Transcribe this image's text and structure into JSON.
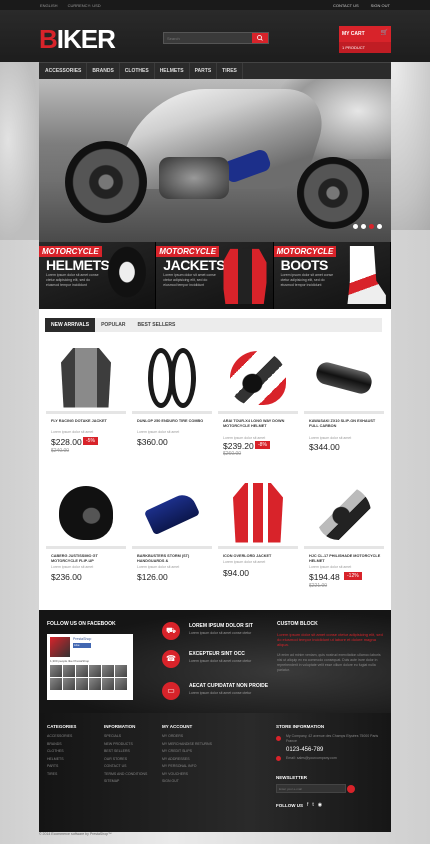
{
  "topbar": {
    "language": "ENGLISH",
    "currency": "CURRENCY: USD",
    "contact": "CONTACT US",
    "signout": "SIGN OUT"
  },
  "header": {
    "logo_first": "B",
    "logo_rest": "IKER",
    "search_placeholder": "Search",
    "cart_label": "MY CART",
    "cart_count": "1 PRODUCT"
  },
  "nav": [
    "ACCESSORIES",
    "BRANDS",
    "CLOTHES",
    "HELMETS",
    "PARTS",
    "TIRES"
  ],
  "banners": [
    {
      "tag": "MOTORCYCLE",
      "big": "HELMETS",
      "text": "Lorem ipsum dolor sit amet conse ctetur adipisicing elit, sed do eiusmod tempor incididunt"
    },
    {
      "tag": "MOTORCYCLE",
      "big": "JACKETS",
      "text": "Lorem ipsum dolor sit amet conse ctetur adipisicing elit, sed do eiusmod tempor incididunt"
    },
    {
      "tag": "MOTORCYCLE",
      "big": "BOOTS",
      "text": "Lorem ipsum dolor sit amet conse ctetur adipisicing elit, sed do eiusmod tempor incididunt"
    }
  ],
  "tabs": [
    "NEW ARRIVALS",
    "POPULAR",
    "BEST SELLERS"
  ],
  "products": [
    {
      "name": "FLY RACING DOTAKE JACKET",
      "desc": "Lorem ipsum dolor sit amet",
      "price": "$228.00",
      "old": "$240.00",
      "discount": "-5%"
    },
    {
      "name": "DUNLOP 250 ENDURO TIRE COMBO",
      "desc": "Lorem ipsum dolor sit amet",
      "price": "$360.00",
      "old": "",
      "discount": ""
    },
    {
      "name": "ARAI TOUR-X4 LONG WAY DOWN MOTORCYCLE HELMET",
      "desc": "Lorem ipsum dolor sit amet",
      "price": "$239.20",
      "old": "$260.00",
      "discount": "-8%"
    },
    {
      "name": "KAWASAKI ZX10 SLIP-ON EXHAUST FULL CARBON",
      "desc": "Lorem ipsum dolor sit amet",
      "price": "$344.00",
      "old": "",
      "discount": ""
    },
    {
      "name": "CABERG JUSTISSIMO GT MOTORCYCLE FLIP-UP",
      "desc": "Lorem ipsum dolor sit amet",
      "price": "$236.00",
      "old": "",
      "discount": ""
    },
    {
      "name": "BARKBUSTERS STORM (ST) HANDGUARDS &",
      "desc": "Lorem ipsum dolor sit amet",
      "price": "$126.00",
      "old": "",
      "discount": ""
    },
    {
      "name": "ICON OVERLORD JACKET",
      "desc": "Lorem ipsum dolor sit amet",
      "price": "$94.00",
      "old": "",
      "discount": ""
    },
    {
      "name": "HJC CL-17 PHILISHADE MOTORCYCLE HELMET",
      "desc": "Lorem ipsum dolor sit amet",
      "price": "$194.48",
      "old": "$221.00",
      "discount": "-12%"
    }
  ],
  "footer": {
    "facebook_title": "FOLLOW US ON FACEBOOK",
    "fb_page": "PrestaShop",
    "fb_like": "Like",
    "fb_people": "1,300 people like PrestaShop",
    "features": [
      {
        "title": "LOREM IPSUM DOLOR SIT",
        "text": "Lorem ipsum dolor sit amet conse ctetur"
      },
      {
        "title": "EXCEPTEUR SINT OCC",
        "text": "Lorem ipsum dolor sit amet conse ctetur"
      },
      {
        "title": "AECAT CUPIDATAT NON PROIDE",
        "text": "Lorem ipsum dolor sit amet conse ctetur"
      }
    ],
    "custom_title": "CUSTOM BLOCK",
    "custom_red": "Lorem ipsum dolor sit amet conse ctetur adipisicing elit, sed do eiusmod tempor incididunt ut labore et dolore magna aliqua.",
    "custom_grey": "Ut enim ad minim veniam, quis nostrud exercitation ullamco laboris nisi ut aliquip ex ea commodo consequat. Duis aute irure dolor in reprehenderit in voluptate velit esse cillum dolore eu fugiat nulla pariatur.",
    "columns": [
      {
        "title": "CATEGORIES",
        "items": [
          "ACCESSORIES",
          "BRANDS",
          "CLOTHES",
          "HELMETS",
          "PARTS",
          "TIRES"
        ]
      },
      {
        "title": "INFORMATION",
        "items": [
          "SPECIALS",
          "NEW PRODUCTS",
          "BEST SELLERS",
          "OUR STORES",
          "CONTACT US",
          "TERMS AND CONDITIONS",
          "SITEMAP"
        ]
      },
      {
        "title": "MY ACCOUNT",
        "items": [
          "MY ORDERS",
          "MY MERCHANDISE RETURNS",
          "MY CREDIT SLIPS",
          "MY ADDRESSES",
          "MY PERSONAL INFO",
          "MY VOUCHERS",
          "SIGN OUT"
        ]
      }
    ],
    "store_title": "STORE INFORMATION",
    "store_addr": "My Company, 42 avenue des Champs Elysées 75000 Paris France",
    "store_phone": "0123-456-789",
    "store_mail": "Email: sales@yourcompany.com",
    "newsletter_title": "NEWSLETTER",
    "newsletter_placeholder": "Enter your e-mail",
    "follow_title": "FOLLOW US",
    "socials": [
      "f",
      "t",
      "rss"
    ]
  },
  "copyright": "© 2014 Ecommerce software by PrestaShop™",
  "colors": {
    "accent": "#d8232a",
    "dark": "#1b1b1b"
  }
}
